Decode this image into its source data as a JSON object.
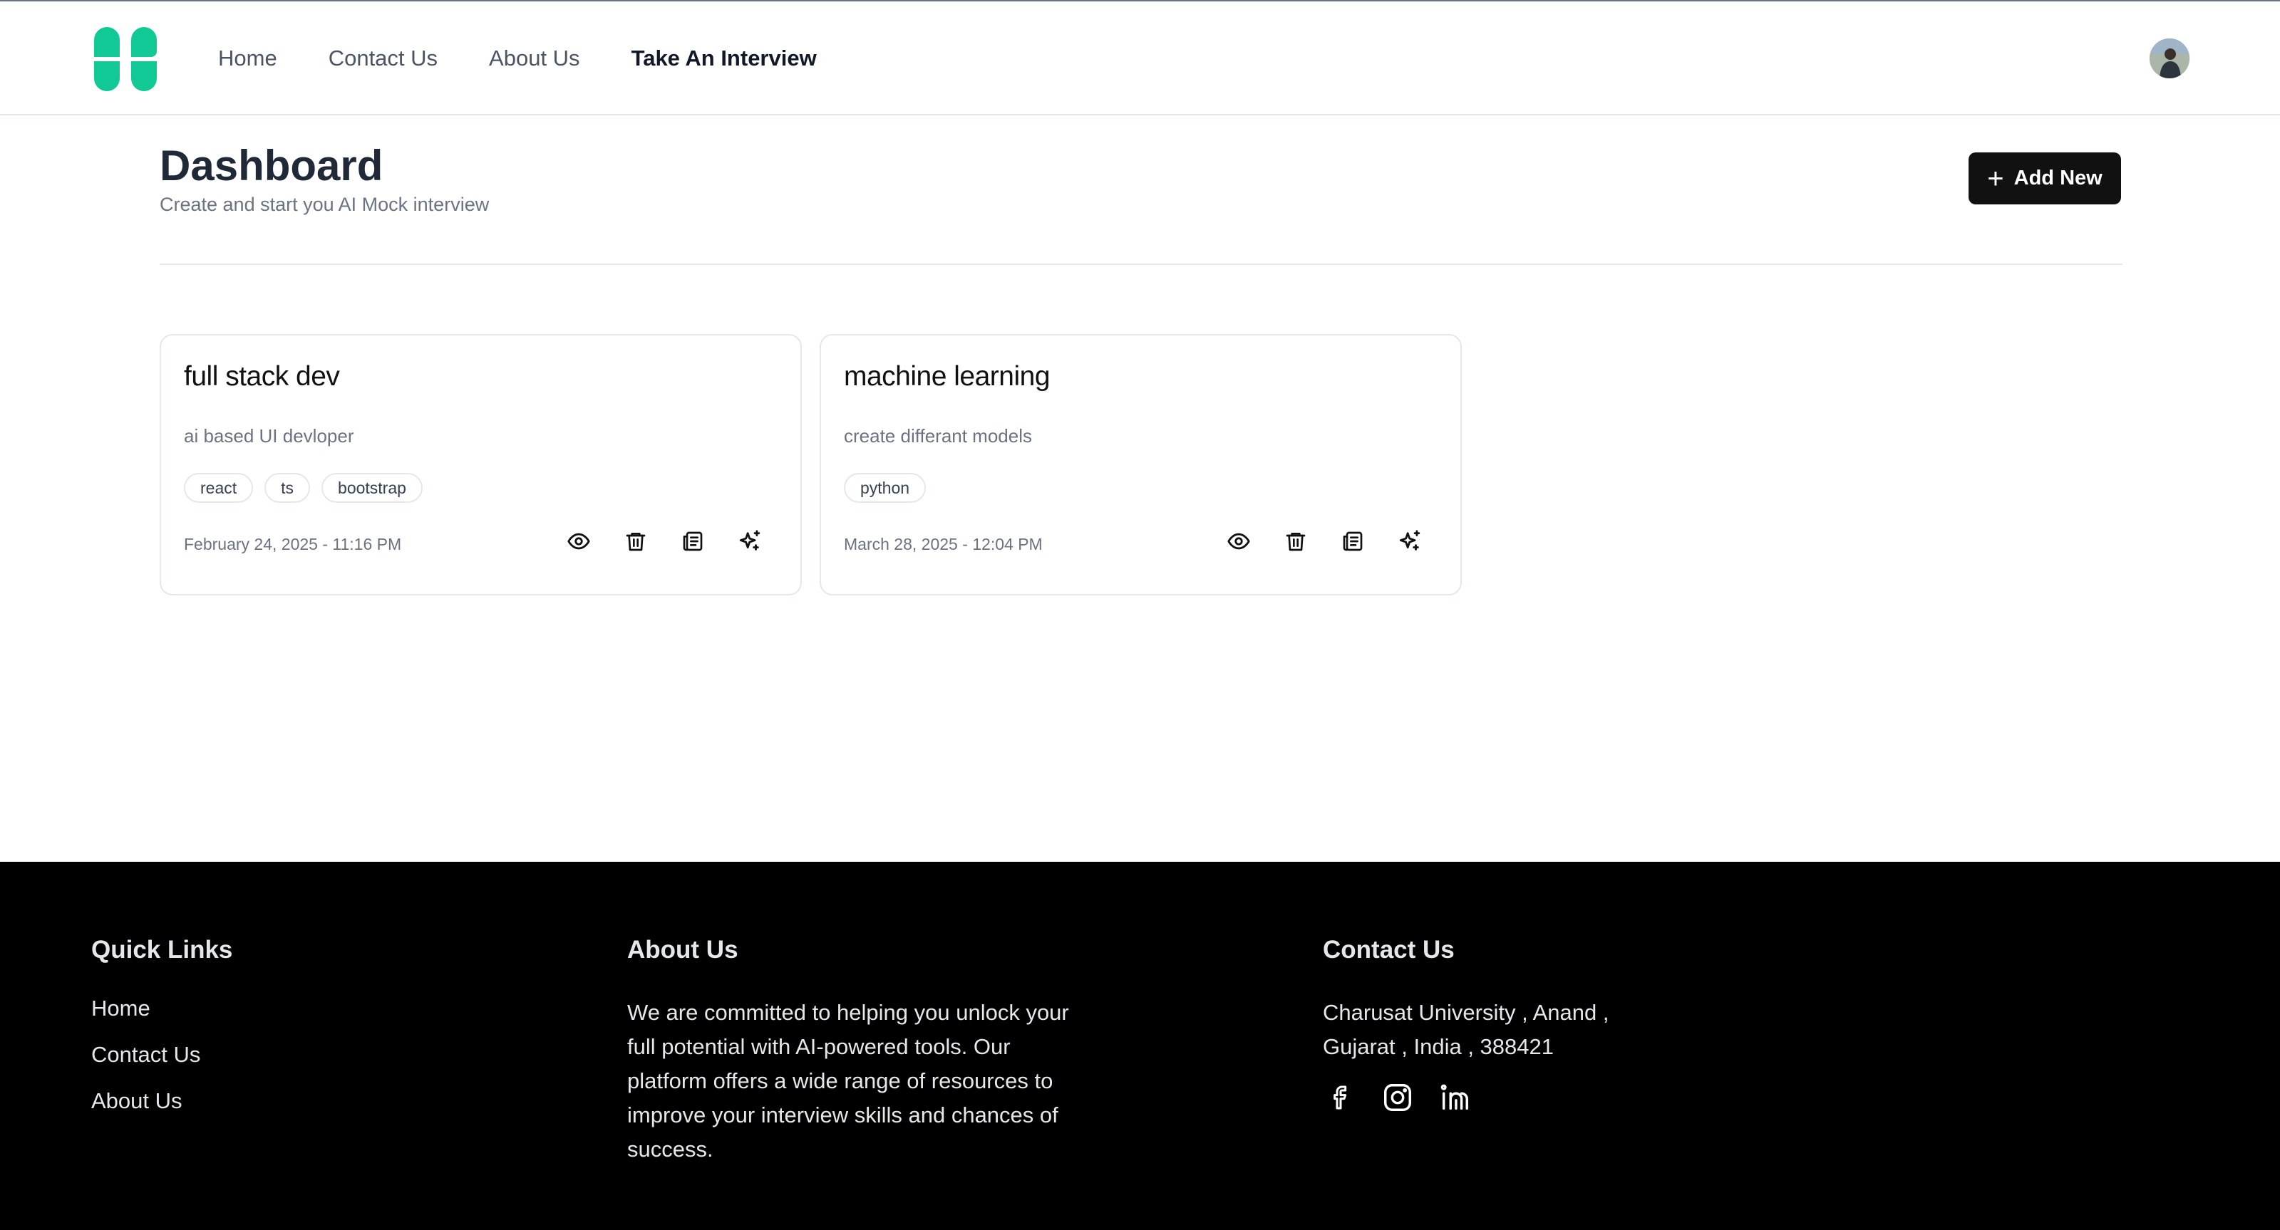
{
  "nav": {
    "home": "Home",
    "contact": "Contact Us",
    "about": "About Us",
    "interview": "Take An Interview"
  },
  "brand_color": "#10c995",
  "dashboard": {
    "title": "Dashboard",
    "subtitle": "Create and start you AI Mock interview",
    "add_button": "Add New"
  },
  "cards": [
    {
      "title": "full stack dev",
      "description": "ai based UI devloper",
      "tags": [
        "react",
        "ts",
        "bootstrap"
      ],
      "date": "February 24, 2025 - 11:16 PM"
    },
    {
      "title": "machine learning",
      "description": "create differant models",
      "tags": [
        "python"
      ],
      "date": "March 28, 2025 - 12:04 PM"
    }
  ],
  "card_actions": [
    "eye-icon",
    "trash-icon",
    "document-icon",
    "sparkles-icon"
  ],
  "footer": {
    "quick_links": {
      "heading": "Quick Links",
      "items": [
        "Home",
        "Contact Us",
        "About Us"
      ]
    },
    "about": {
      "heading": "About Us",
      "lines": [
        "We are committed to helping you unlock your",
        "full potential with AI-powered tools. Our",
        "platform offers a wide range of resources to",
        "improve your interview skills and chances of",
        "success."
      ]
    },
    "contact": {
      "heading": "Contact Us",
      "lines": [
        "Charusat University , Anand ,",
        "Gujarat , India , 388421"
      ],
      "social": [
        "facebook-icon",
        "instagram-icon",
        "linkedin-icon"
      ]
    }
  }
}
